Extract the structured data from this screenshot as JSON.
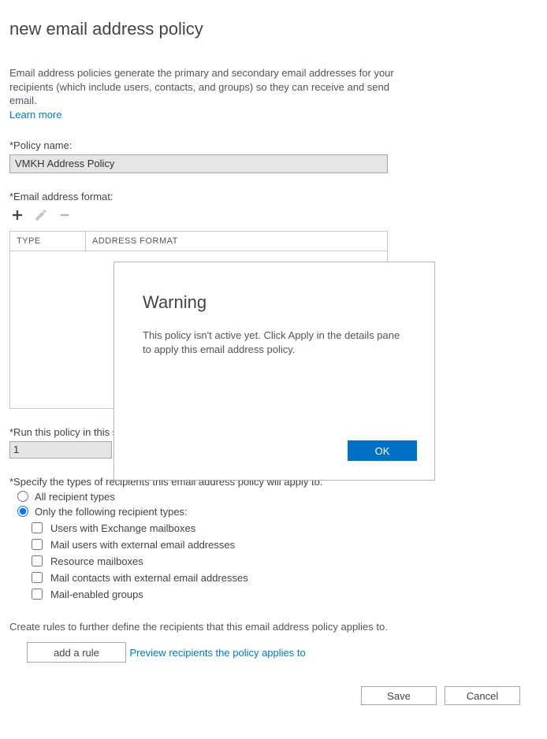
{
  "page": {
    "title": "new email address policy",
    "intro": "Email address policies generate the primary and secondary email addresses for your recipients (which include users, contacts, and groups) so they can receive and send email.",
    "learn_more": "Learn more"
  },
  "policy": {
    "name_label": "*Policy name:",
    "name_value": "VMKH Address Policy"
  },
  "format": {
    "label": "*Email address format:",
    "columns": {
      "type": "TYPE",
      "address": "ADDRESS FORMAT"
    }
  },
  "sequence": {
    "label": "*Run this policy in this sequence with other policies:",
    "value": "1"
  },
  "recipient_spec": {
    "label": "*Specify the types of recipients this email address policy will apply to.",
    "radios": {
      "all": "All recipient types",
      "only": "Only the following recipient types:"
    },
    "checks": [
      "Users with Exchange mailboxes",
      "Mail users with external email addresses",
      "Resource mailboxes",
      "Mail contacts with external email addresses",
      "Mail-enabled groups"
    ]
  },
  "rules": {
    "text": "Create rules to further define the recipients that this email address policy applies to.",
    "add_button": "add a rule"
  },
  "preview_link": "Preview recipients the policy applies to",
  "footer": {
    "save": "Save",
    "cancel": "Cancel"
  },
  "modal": {
    "title": "Warning",
    "body": "This policy isn't active yet. Click Apply in the details pane to apply this email address policy.",
    "ok": "OK"
  }
}
